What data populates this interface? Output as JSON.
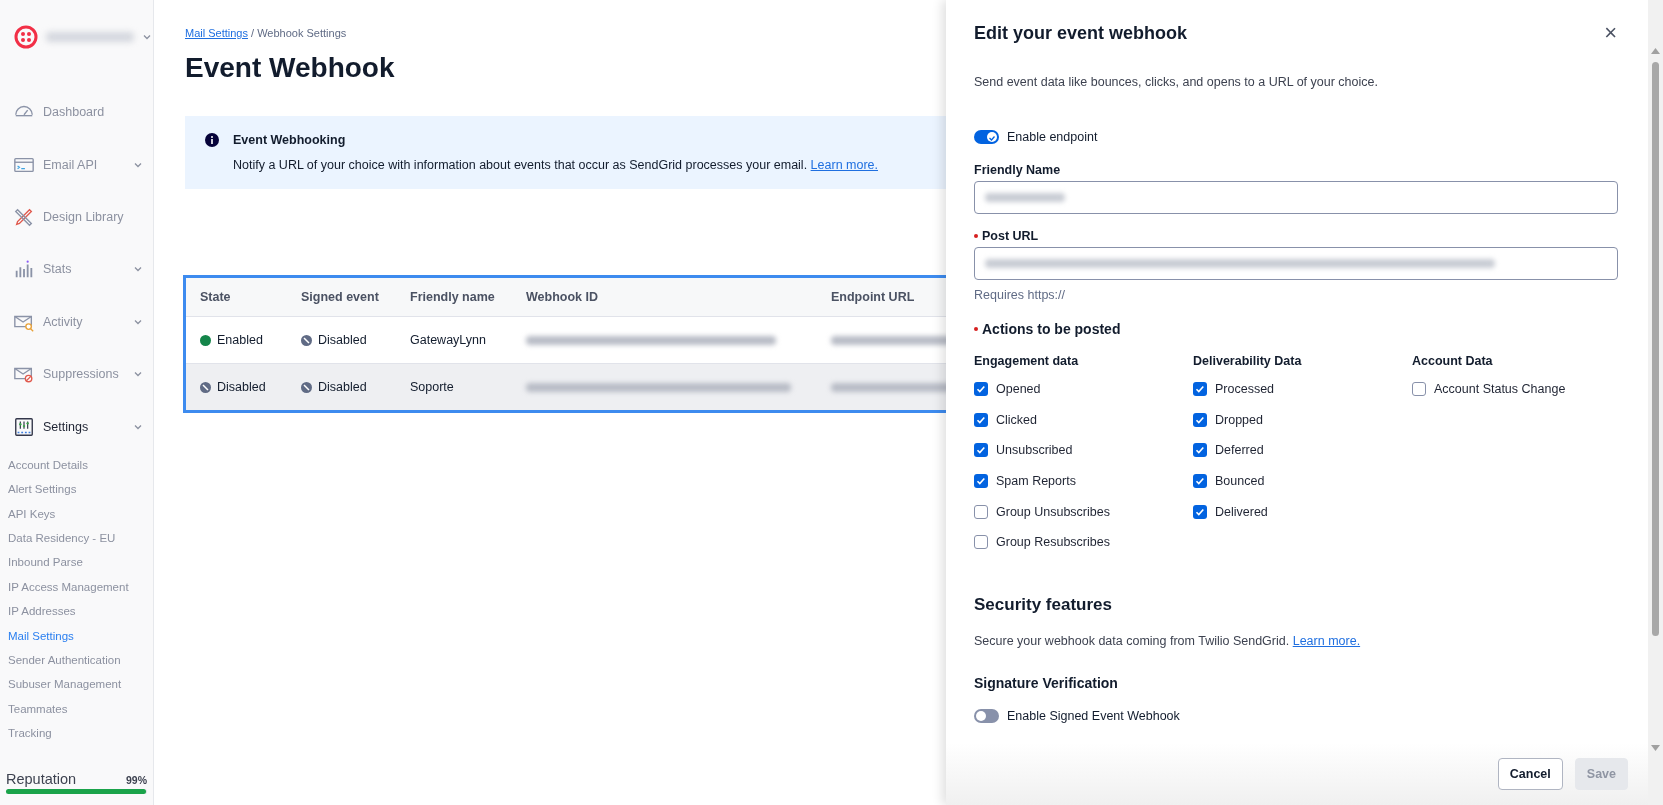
{
  "sidebar": {
    "nav": [
      {
        "label": "Dashboard",
        "expandable": false
      },
      {
        "label": "Email API",
        "expandable": true
      },
      {
        "label": "Design Library",
        "expandable": false
      },
      {
        "label": "Stats",
        "expandable": true
      },
      {
        "label": "Activity",
        "expandable": true
      },
      {
        "label": "Suppressions",
        "expandable": true
      },
      {
        "label": "Settings",
        "expandable": true,
        "children": [
          {
            "label": "Account Details",
            "selected": false
          },
          {
            "label": "Alert Settings",
            "selected": false
          },
          {
            "label": "API Keys",
            "selected": false
          },
          {
            "label": "Data Residency - EU",
            "selected": false
          },
          {
            "label": "Inbound Parse",
            "selected": false
          },
          {
            "label": "IP Access Management",
            "selected": false
          },
          {
            "label": "IP Addresses",
            "selected": false
          },
          {
            "label": "Mail Settings",
            "selected": true
          },
          {
            "label": "Sender Authentication",
            "selected": false
          },
          {
            "label": "Subuser Management",
            "selected": false
          },
          {
            "label": "Teammates",
            "selected": false
          },
          {
            "label": "Tracking",
            "selected": false
          }
        ]
      }
    ],
    "reputation": {
      "label": "Reputation",
      "value": "99%",
      "level": 0.99
    }
  },
  "breadcrumb": {
    "link": "Mail Settings",
    "separator": "/",
    "current": "Webhook Settings"
  },
  "page_title": "Event Webhook",
  "info_banner": {
    "title": "Event Webhooking",
    "text": "Notify a URL of your choice with information about events that occur as SendGrid processes your email.",
    "link": "Learn more."
  },
  "table": {
    "columns": [
      "State",
      "Signed event",
      "Friendly name",
      "Webhook ID",
      "Endpoint URL"
    ],
    "rows": [
      {
        "state": {
          "label": "Enabled",
          "kind": "enabled"
        },
        "signed": {
          "label": "Disabled",
          "kind": "disabled"
        },
        "friendly_name": "GatewayLynn",
        "highlighted": false
      },
      {
        "state": {
          "label": "Disabled",
          "kind": "disabled"
        },
        "signed": {
          "label": "Disabled",
          "kind": "disabled"
        },
        "friendly_name": "Soporte",
        "highlighted": true
      }
    ]
  },
  "drawer": {
    "title": "Edit your event webhook",
    "close": "×",
    "description": "Send event data like bounces, clicks, and opens to a URL of your choice.",
    "enable_toggle": {
      "label": "Enable endpoint",
      "on": true
    },
    "fields": [
      {
        "label": "Friendly Name",
        "required": false
      },
      {
        "label": "Post URL",
        "required": true
      }
    ],
    "hint": "Requires https://",
    "actions_heading": {
      "text": "Actions to be posted",
      "required": true
    },
    "groups": [
      {
        "heading": "Engagement data",
        "options": [
          {
            "label": "Opened",
            "checked": true
          },
          {
            "label": "Clicked",
            "checked": true
          },
          {
            "label": "Unsubscribed",
            "checked": true
          },
          {
            "label": "Spam Reports",
            "checked": true
          },
          {
            "label": "Group Unsubscribes",
            "checked": false
          },
          {
            "label": "Group Resubscribes",
            "checked": false
          }
        ]
      },
      {
        "heading": "Deliverability Data",
        "options": [
          {
            "label": "Processed",
            "checked": true
          },
          {
            "label": "Dropped",
            "checked": true
          },
          {
            "label": "Deferred",
            "checked": true
          },
          {
            "label": "Bounced",
            "checked": true
          },
          {
            "label": "Delivered",
            "checked": true
          }
        ]
      },
      {
        "heading": "Account Data",
        "options": [
          {
            "label": "Account Status Change",
            "checked": false
          }
        ]
      }
    ],
    "security": {
      "heading": "Security features",
      "text": "Secure your webhook data coming from Twilio SendGrid.",
      "link": "Learn more."
    },
    "signature": {
      "heading": "Signature Verification",
      "toggle": {
        "label": "Enable Signed Event Webhook",
        "on": false
      }
    },
    "buttons": [
      {
        "label": "Cancel",
        "disabled": false
      },
      {
        "label": "Save",
        "disabled": true
      }
    ]
  }
}
